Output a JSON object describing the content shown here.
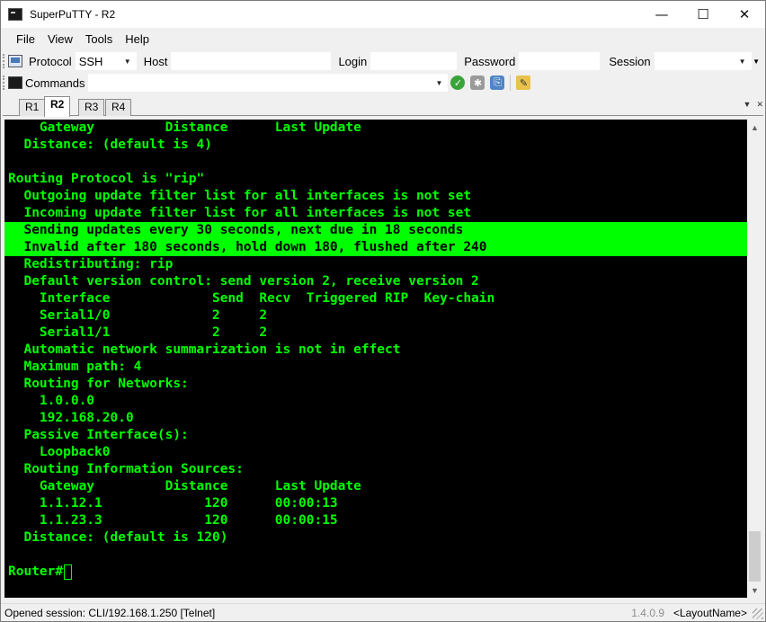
{
  "window": {
    "title": "SuperPuTTY - R2",
    "controls": {
      "minimize": "—",
      "maximize": "☐",
      "close": "✕"
    }
  },
  "menu": [
    "File",
    "View",
    "Tools",
    "Help"
  ],
  "connect_bar": {
    "protocol_label": "Protocol",
    "protocol_value": "SSH",
    "host_label": "Host",
    "host_value": "",
    "login_label": "Login",
    "login_value": "",
    "password_label": "Password",
    "password_value": "",
    "session_label": "Session",
    "session_value": ""
  },
  "commands_bar": {
    "label": "Commands",
    "value": ""
  },
  "tabs": [
    {
      "label": "R1",
      "active": false
    },
    {
      "label": "R2",
      "active": true
    },
    {
      "label": "R3",
      "active": false
    },
    {
      "label": "R4",
      "active": false
    }
  ],
  "terminal": {
    "lines": [
      "    Gateway         Distance      Last Update",
      "  Distance: (default is 4)",
      "",
      "Routing Protocol is \"rip\"",
      "  Outgoing update filter list for all interfaces is not set",
      "  Incoming update filter list for all interfaces is not set",
      "  Sending updates every 30 seconds, next due in 18 seconds",
      "  Invalid after 180 seconds, hold down 180, flushed after 240",
      "  Redistributing: rip",
      "  Default version control: send version 2, receive version 2",
      "    Interface             Send  Recv  Triggered RIP  Key-chain",
      "    Serial1/0             2     2",
      "    Serial1/1             2     2",
      "  Automatic network summarization is not in effect",
      "  Maximum path: 4",
      "  Routing for Networks:",
      "    1.0.0.0",
      "    192.168.20.0",
      "  Passive Interface(s):",
      "    Loopback0",
      "  Routing Information Sources:",
      "    Gateway         Distance      Last Update",
      "    1.1.12.1             120      00:00:13",
      "    1.1.23.3             120      00:00:15",
      "  Distance: (default is 120)",
      "",
      "Router#"
    ],
    "highlighted_lines": [
      6,
      7
    ],
    "text_color": "#00ff00",
    "background": "#000000",
    "scroll_position": 0.92
  },
  "status": {
    "session": "Opened session: CLI/192.168.1.250 [Telnet]",
    "version": "1.4.0.9",
    "layout": "<LayoutName>"
  }
}
